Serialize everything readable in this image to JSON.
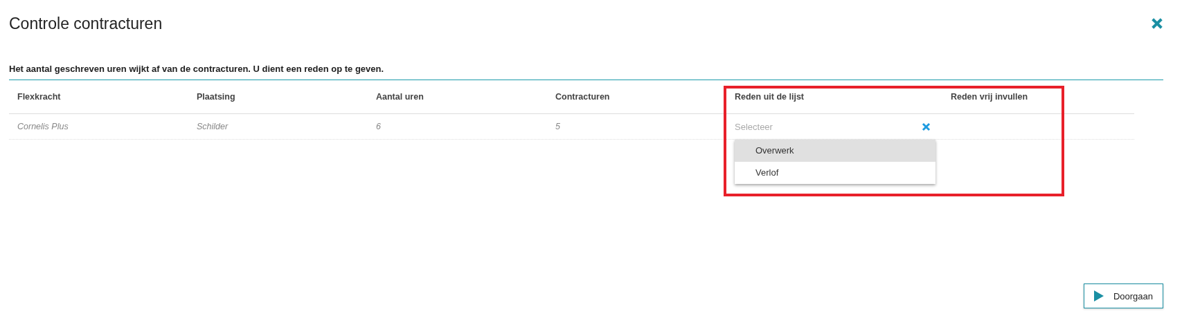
{
  "dialog": {
    "title": "Controle contracturen"
  },
  "message": "Het aantal geschreven uren wijkt af van de contracturen. U dient een reden op te geven.",
  "table": {
    "columns": [
      "Flexkracht",
      "Plaatsing",
      "Aantal uren",
      "Contracturen",
      "Reden uit de lijst",
      "Reden vrij invullen"
    ],
    "rows": [
      {
        "cells": [
          "Cornelis Plus",
          "Schilder",
          "6",
          "5"
        ],
        "reason_select": {
          "placeholder": "Selecteer",
          "open": true,
          "options": [
            {
              "label": "Overwerk",
              "selected": true
            },
            {
              "label": "Verlof",
              "selected": false
            }
          ]
        }
      }
    ]
  },
  "highlight": true,
  "buttons": [
    {
      "label": "Doorgaan"
    }
  ]
}
